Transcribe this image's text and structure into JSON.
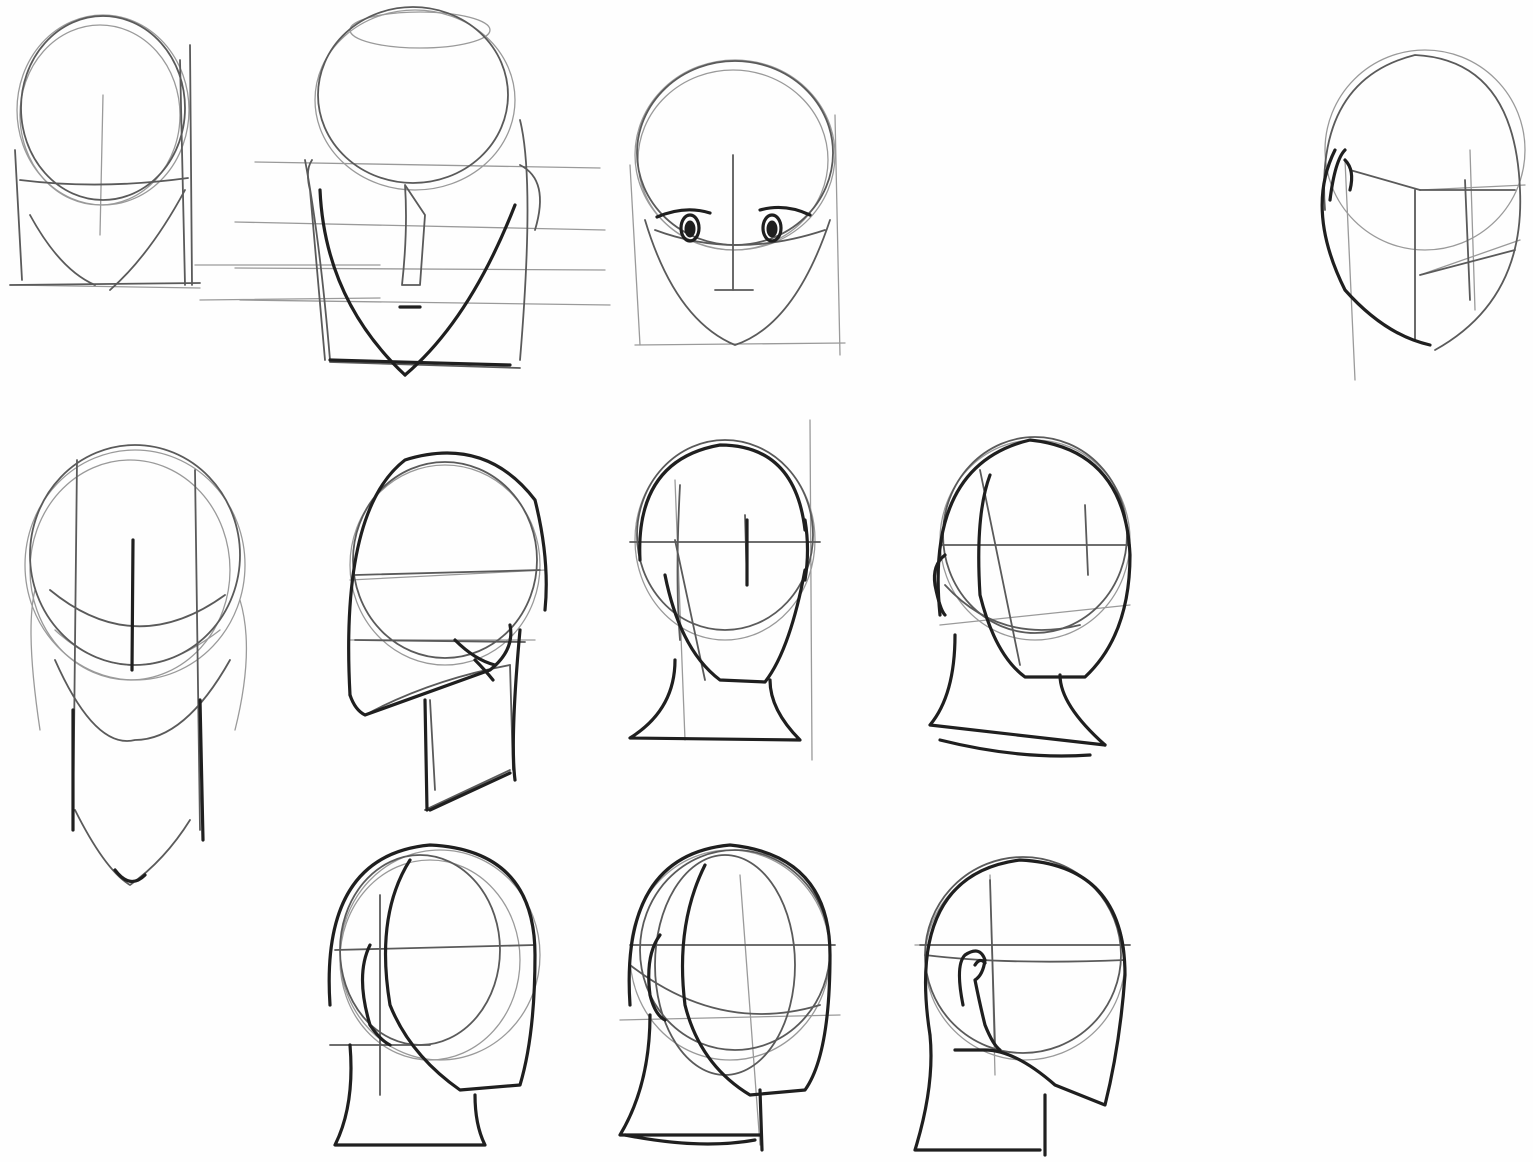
{
  "sheet": {
    "background": "#ffffff",
    "line_color_dark": "#1f1f1f",
    "line_color_light": "#9a9a9a"
  },
  "heads": [
    {
      "id": "front-construction-basic",
      "view": "front"
    },
    {
      "id": "front-with-nose",
      "view": "front"
    },
    {
      "id": "front-with-eyes",
      "view": "front"
    },
    {
      "id": "three-quarter-top-right",
      "view": "three-quarter"
    },
    {
      "id": "front-elongated",
      "view": "front"
    },
    {
      "id": "three-quarter-jaw-box",
      "view": "three-quarter"
    },
    {
      "id": "front-with-neck",
      "view": "front"
    },
    {
      "id": "three-quarter-with-neck",
      "view": "three-quarter"
    },
    {
      "id": "three-quarter-left-bottom",
      "view": "three-quarter"
    },
    {
      "id": "three-quarter-center-bottom",
      "view": "three-quarter"
    },
    {
      "id": "profile-with-ear",
      "view": "side"
    }
  ]
}
